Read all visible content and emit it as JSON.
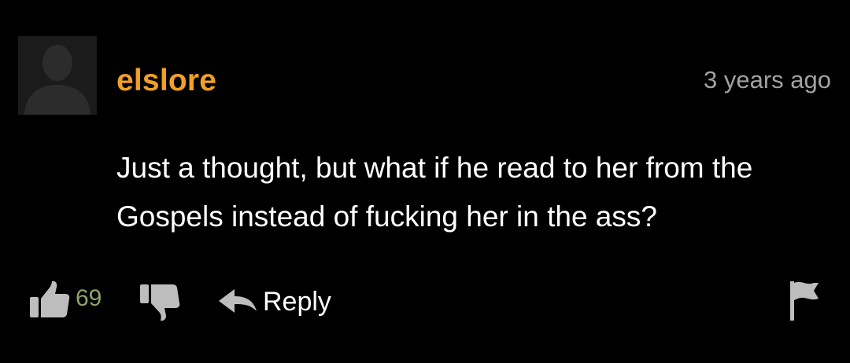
{
  "comment": {
    "username": "elslore",
    "timestamp": "3 years ago",
    "body": "Just a thought, but what if he read to her from the Gospels instead of fucking her in the ass?",
    "avatar_icon": "default-user-silhouette-icon"
  },
  "actions": {
    "upvote_count": "69",
    "reply_label": "Reply",
    "icons": {
      "upvote": "thumbs-up-icon",
      "downvote": "thumbs-down-icon",
      "reply": "reply-arrow-icon",
      "flag": "flag-icon"
    }
  },
  "colors": {
    "background": "#000000",
    "username": "#f0a025",
    "timestamp": "#a2a2a2",
    "body_text": "#ffffff",
    "vote_count": "#8fa26a",
    "icon_gray": "#bdbdbd",
    "avatar_bg": "#1b1b1b",
    "avatar_silhouette": "#2c2c2c"
  }
}
